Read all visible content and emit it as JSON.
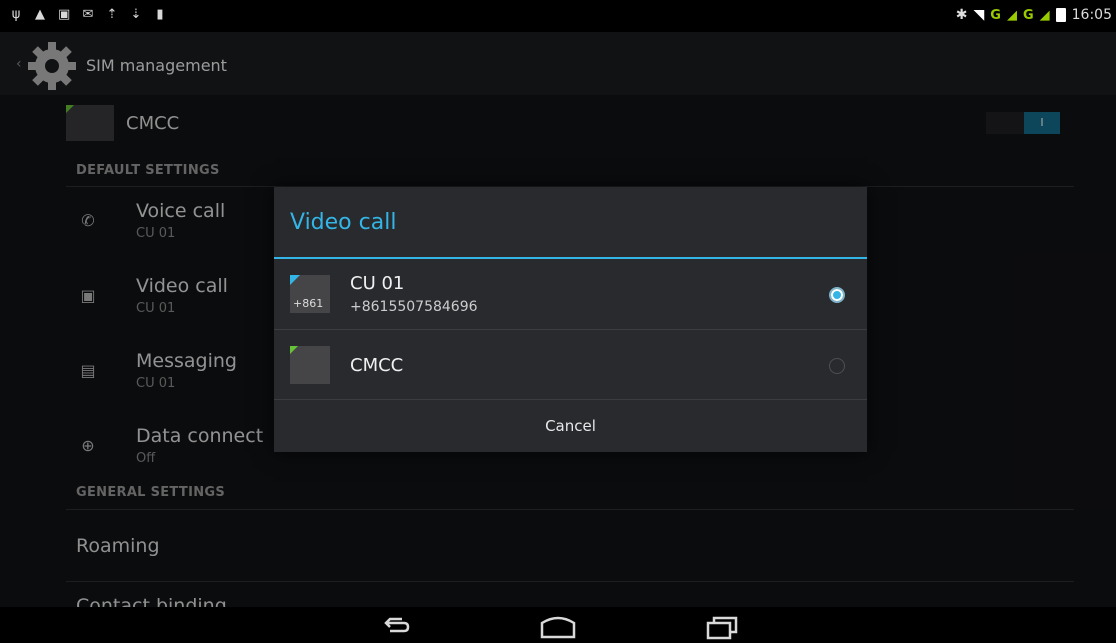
{
  "status_bar": {
    "left_icons": [
      "usb-icon",
      "lock-icon",
      "image-icon",
      "mail-icon",
      "upload-icon",
      "download-icon",
      "storage-icon"
    ],
    "network_label_1": "G",
    "network_label_2": "G",
    "time": "16:05"
  },
  "app_bar": {
    "title": "SIM management"
  },
  "settings": {
    "sim_card_name": "CMCC",
    "toggle_label": "I",
    "default_section_title": "DEFAULT SETTINGS",
    "items": [
      {
        "title": "Voice call",
        "subtitle": "CU 01"
      },
      {
        "title": "Video call",
        "subtitle": "CU 01"
      },
      {
        "title": "Messaging",
        "subtitle": "CU 01"
      },
      {
        "title": "Data connect",
        "subtitle": "Off"
      }
    ],
    "general_section_title": "GENERAL SETTINGS",
    "roaming": "Roaming",
    "contact_binding": "Contact binding"
  },
  "dialog": {
    "title": "Video call",
    "options": [
      {
        "name": "CU 01",
        "number": "+8615507584696",
        "chip_label": "+861",
        "selected": true
      },
      {
        "name": "CMCC",
        "number": "",
        "chip_label": "",
        "selected": false
      }
    ],
    "cancel_label": "Cancel"
  },
  "colors": {
    "accent": "#33b5e5",
    "sim_green": "#67c23a",
    "signal_green": "#99cc00"
  }
}
